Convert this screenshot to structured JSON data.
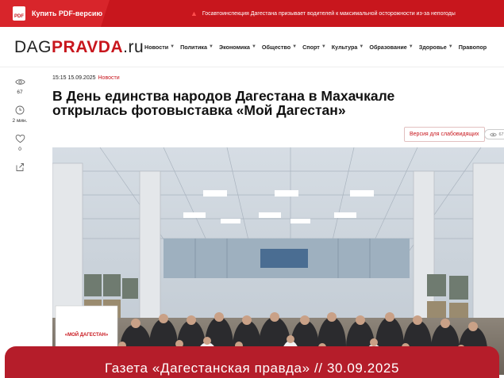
{
  "topbar": {
    "pdf_icon_text": "PDF",
    "pdf_label": "Купить PDF-версию",
    "ticker_text": "Госавтоинспекция Дагестана призывает водителей к максимальной осторожности из-за непогоды"
  },
  "logo": {
    "part1": "DAG",
    "part2": "PRAVDA",
    "part3": ".ru"
  },
  "nav": {
    "items": [
      {
        "label": "Новости"
      },
      {
        "label": "Политика"
      },
      {
        "label": "Экономика"
      },
      {
        "label": "Общество"
      },
      {
        "label": "Спорт"
      },
      {
        "label": "Культура"
      },
      {
        "label": "Образование"
      },
      {
        "label": "Здоровье"
      },
      {
        "label": "Правопор"
      }
    ]
  },
  "rail": {
    "views": "67",
    "read_time": "2 мин.",
    "likes": "0"
  },
  "article": {
    "datetime": "15:15 15.09.2025",
    "category": "Новости",
    "title": "В День единства народов Дагестана в Махачкале открылась фотовыставка «Мой Дагестан»",
    "accessibility_label": "Версия для слабовидящих",
    "eye_count": "67"
  },
  "photo": {
    "banner_text": "«МОЙ ДАГЕСТАН»"
  },
  "footer": {
    "text": "Газета «Дагестанская правда» // 30.09.2025"
  },
  "colors": {
    "brand_red": "#c8161d",
    "footer_red": "#b51d2a"
  }
}
